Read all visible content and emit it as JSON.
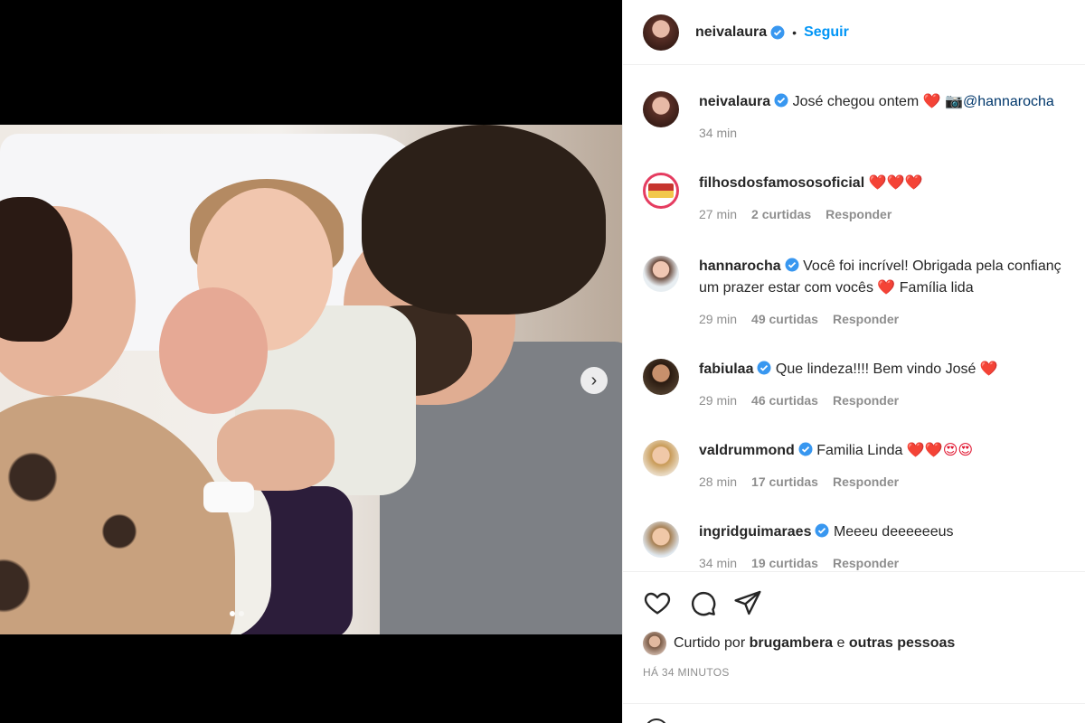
{
  "post": {
    "author": "neivalaura",
    "follow_label": "Seguir",
    "bullet": "•"
  },
  "media": {
    "carousel_dots": 2,
    "active_dot": 0,
    "next_label": "›"
  },
  "comments": [
    {
      "user": "neivalaura",
      "verified": true,
      "text": "José chegou ontem",
      "emojis": "❤️",
      "camera": "📷",
      "mention": "@hannarocha",
      "time": "34 min",
      "likes": "",
      "reply": ""
    },
    {
      "user": "filhosdosfamososoficial",
      "verified": false,
      "text": "",
      "emojis": "❤️❤️❤️",
      "time": "27 min",
      "likes": "2 curtidas",
      "reply": "Responder"
    },
    {
      "user": "hannarocha",
      "verified": true,
      "text": "Você foi incrível! Obrigada pela confianç",
      "text2": "um prazer estar com vocês",
      "emojis2": "❤️",
      "text3": "Família lida",
      "time": "29 min",
      "likes": "49 curtidas",
      "reply": "Responder"
    },
    {
      "user": "fabiulaa",
      "verified": true,
      "text": "Que lindeza!!!! Bem vindo José",
      "emojis": "❤️",
      "time": "29 min",
      "likes": "46 curtidas",
      "reply": "Responder"
    },
    {
      "user": "valdrummond",
      "verified": true,
      "text": "Familia Linda",
      "emojis": "❤️❤️😍😍",
      "time": "28 min",
      "likes": "17 curtidas",
      "reply": "Responder"
    },
    {
      "user": "ingridguimaraes",
      "verified": true,
      "text": "Meeeu deeeeeeus",
      "emojis": "",
      "time": "34 min",
      "likes": "19 curtidas",
      "reply": "Responder"
    }
  ],
  "actions": {
    "liked_prefix": "Curtido por",
    "liked_user": "brugambera",
    "liked_conj": "e",
    "liked_others": "outras pessoas",
    "time_ago": "HÁ 34 MINUTOS"
  },
  "colors": {
    "accent": "#0095f6",
    "verified": "#3897f0",
    "heart": "#e0102b"
  }
}
